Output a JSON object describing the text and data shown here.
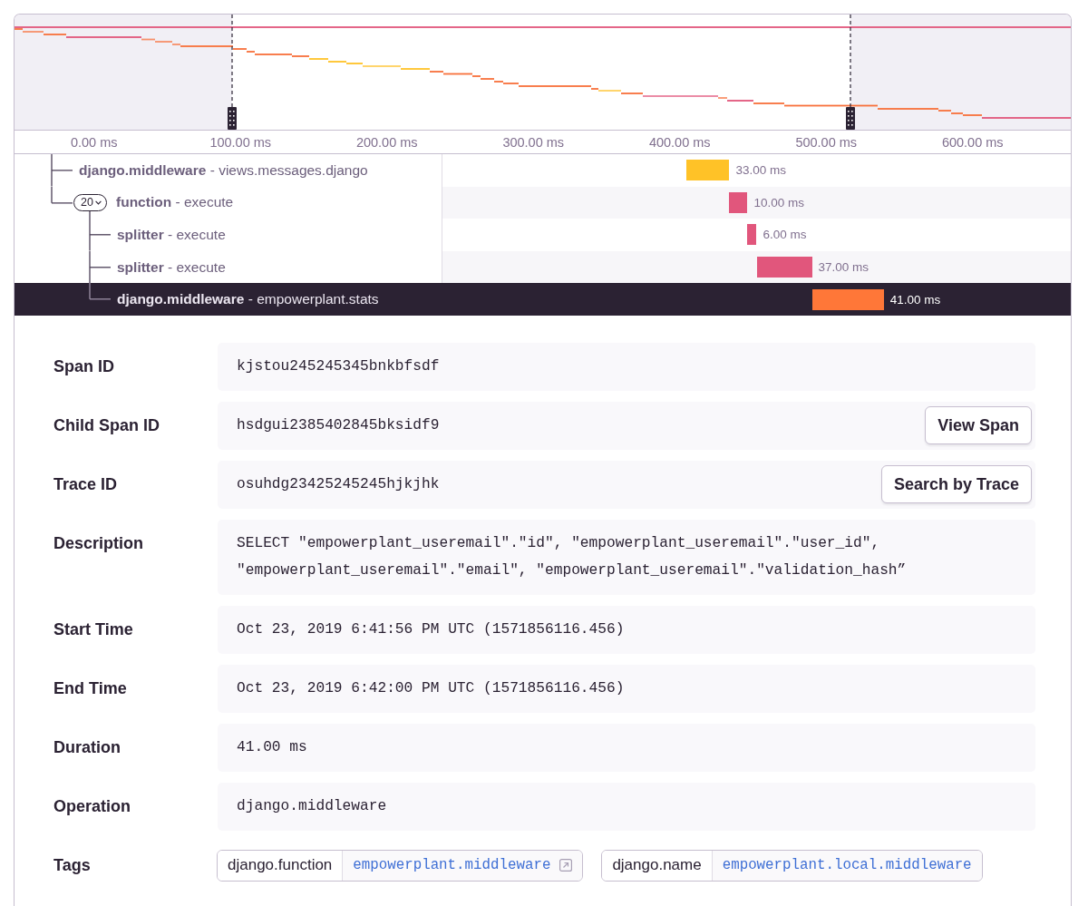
{
  "timeline": {
    "ticks": [
      "0.00 ms",
      "100.00 ms",
      "200.00 ms",
      "300.00 ms",
      "400.00 ms",
      "500.00 ms",
      "600.00 ms"
    ]
  },
  "spans": [
    {
      "label": "**django.middleware** - views.messages.django",
      "duration": "33.00 ms",
      "color": "#ffc227",
      "selected": false
    },
    {
      "label": "**function** - execute",
      "duration": "10.00 ms",
      "color": "#e1567c",
      "selected": false,
      "child_count": "20",
      "children": [
        {
          "label": "**splitter** - execute",
          "duration": "6.00 ms",
          "color": "#e1567c",
          "selected": false
        },
        {
          "label": "**splitter** - execute",
          "duration": "37.00 ms",
          "color": "#e1567c",
          "selected": false
        },
        {
          "label": "**django.middleware** - empowerplant.stats",
          "duration": "41.00 ms",
          "color": "#ff7738",
          "selected": true
        }
      ]
    }
  ],
  "details": [
    {
      "label": "Span ID",
      "value": "kjstou245245345bnkbfsdf"
    },
    {
      "label": "Child Span ID",
      "value": "hsdgui2385402845bksidf9",
      "button": "View Span"
    },
    {
      "label": "Trace ID",
      "value": "osuhdg23425245245hjkjhk",
      "button": "Search by Trace"
    },
    {
      "label": "Description",
      "value": "SELECT \"empowerplant_useremail\".\"id\", \"empowerplant_useremail\".\"user_id\", \"empowerplant_useremail\".\"email\", \"empowerplant_useremail\".\"validation_hash”"
    },
    {
      "label": "Start Time",
      "value": "Oct 23, 2019 6:41:56 PM UTC (1571856116.456)"
    },
    {
      "label": "End Time",
      "value": "Oct 23, 2019 6:42:00 PM UTC (1571856116.456)"
    },
    {
      "label": "Duration",
      "value": "41.00 ms"
    },
    {
      "label": "Operation",
      "value": "django.middleware"
    }
  ],
  "tags": {
    "label": "Tags",
    "items": [
      {
        "key": "django.function",
        "value": "empowerplant.middleware",
        "external_link": true
      },
      {
        "key": "django.name",
        "value": "empowerplant.local.middleware",
        "external_link": false
      }
    ]
  }
}
